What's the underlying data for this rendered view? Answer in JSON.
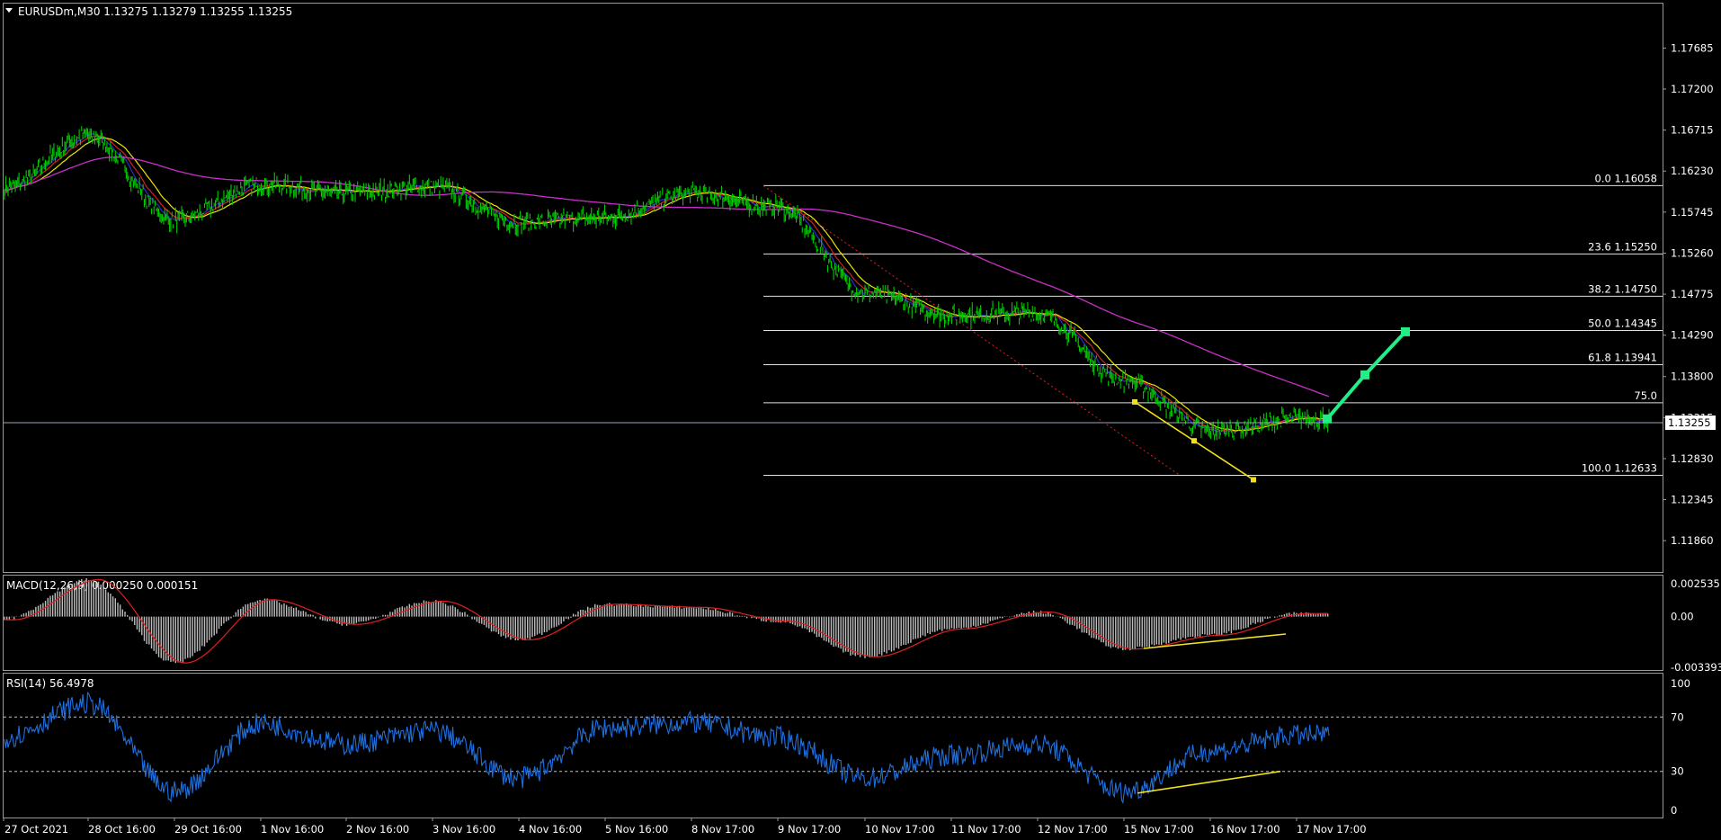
{
  "header": {
    "symbol_line": "EURUSDm,M30  1.13275 1.13279 1.13255 1.13255"
  },
  "colors": {
    "background": "#000000",
    "candle": "#00cc00",
    "ma_fast": "#2a2ad0",
    "ma_mid": "#d42020",
    "ma_slow": "#e8e800",
    "ma_long": "#c830c8",
    "fib": "#e0e0e0",
    "price_line": "#9aa8b8",
    "projection": "#22ee88",
    "trendline": "#f0e020",
    "macd_hist": "#bdbdbd",
    "macd_signal": "#e02020",
    "rsi_line": "#1e6fe0",
    "grid_dotted": "#c0c0c0"
  },
  "chart_data": [
    {
      "type": "line",
      "title": "EURUSDm,M30  1.13275 1.13279 1.13255 1.13255",
      "ylim": [
        1.115,
        1.182
      ],
      "yticks": [
        "1.17685",
        "1.17200",
        "1.16715",
        "1.16230",
        "1.15745",
        "1.15260",
        "1.14775",
        "1.14290",
        "1.13800",
        "1.13315",
        "1.12830",
        "1.12345",
        "1.11860"
      ],
      "current_price_label": "1.13255",
      "current_price": 1.13255,
      "x_labels": [
        "27 Oct 2021",
        "28 Oct 16:00",
        "29 Oct 16:00",
        "1 Nov 16:00",
        "2 Nov 16:00",
        "3 Nov 16:00",
        "4 Nov 16:00",
        "5 Nov 16:00",
        "8 Nov 17:00",
        "9 Nov 17:00",
        "10 Nov 17:00",
        "11 Nov 17:00",
        "12 Nov 17:00",
        "15 Nov 17:00",
        "16 Nov 17:00",
        "17 Nov 17:00"
      ],
      "series": [
        {
          "values_by_session": [
            1.1602,
            1.1665,
            1.1565,
            1.1607,
            1.1597,
            1.1605,
            1.1562,
            1.1568,
            1.1597,
            1.158,
            1.148,
            1.1452,
            1.1455,
            1.1375,
            1.1315,
            1.133
          ]
        }
      ],
      "fibonacci_levels": [
        {
          "label": "0.0 1.16058",
          "price": 1.16058
        },
        {
          "label": "23.6 1.15250",
          "price": 1.1525
        },
        {
          "label": "38.2 1.14750",
          "price": 1.1475
        },
        {
          "label": "50.0 1.14345",
          "price": 1.14345
        },
        {
          "label": "61.8 1.13941",
          "price": 1.13941
        },
        {
          "label": "75.0",
          "price": 1.1349
        },
        {
          "label": "100.0 1.12633",
          "price": 1.12633
        }
      ],
      "projection_arrow": [
        {
          "x_label": "17 Nov 17:00",
          "price": 1.133
        },
        {
          "x_label": "17 Nov 17:00",
          "price": 1.1382
        },
        {
          "x_label": "17 Nov 17:00",
          "price": 1.1433
        }
      ]
    },
    {
      "type": "bar",
      "title": "MACD(12,26,9) 0.000250 0.000151",
      "yticks": [
        "0.002535",
        "0.00",
        "-0.003393"
      ],
      "ylim": [
        -0.0034,
        0.0026
      ],
      "values_by_session": [
        -0.0002,
        0.0024,
        -0.003,
        0.0011,
        -0.0005,
        0.001,
        -0.0015,
        0.0008,
        0.0006,
        -0.0003,
        -0.0026,
        -0.0008,
        0.0003,
        -0.0021,
        -0.0012,
        0.0002
      ]
    },
    {
      "type": "line",
      "title": "RSI(14) 56.4978",
      "yticks": [
        "100",
        "70",
        "30",
        "0"
      ],
      "ylim": [
        0,
        100
      ],
      "levels": [
        70,
        30
      ],
      "values_by_session": [
        55,
        80,
        15,
        65,
        50,
        60,
        25,
        62,
        66,
        55,
        25,
        42,
        50,
        15,
        45,
        56.5
      ]
    }
  ]
}
